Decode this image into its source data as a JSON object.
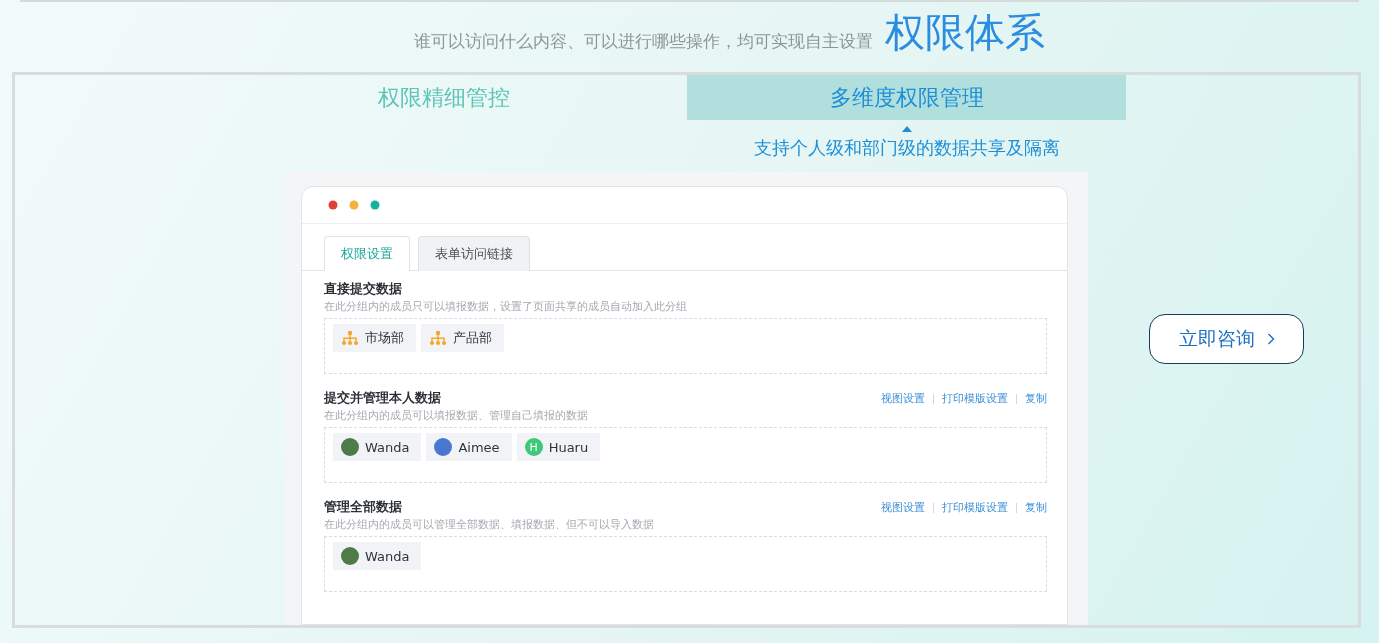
{
  "header": {
    "subtitle": "谁可以访问什么内容、可以进行哪些操作，均可实现自主设置",
    "title": "权限体系"
  },
  "tabs": [
    {
      "label": "权限精细管控",
      "selected": false
    },
    {
      "label": "多维度权限管理",
      "selected": true
    }
  ],
  "tab_caption": "支持个人级和部门级的数据共享及隔离",
  "app_window": {
    "tabs": [
      {
        "label": "权限设置",
        "selected": true
      },
      {
        "label": "表单访问链接",
        "selected": false
      }
    ],
    "groups": [
      {
        "title": "直接提交数据",
        "description": "在此分组内的成员只可以填报数据，设置了页面共享的成员自动加入此分组",
        "members": [
          {
            "kind": "department",
            "name": "市场部"
          },
          {
            "kind": "department",
            "name": "产品部"
          }
        ]
      },
      {
        "title": "提交并管理本人数据",
        "description": "在此分组内的成员可以填报数据、管理自己填报的数据",
        "actions": [
          "视图设置",
          "打印模版设置",
          "复制"
        ],
        "members": [
          {
            "kind": "photo",
            "name": "Wanda",
            "color": "#4f7a4a"
          },
          {
            "kind": "photo",
            "name": "Aimee",
            "color": "#4a78d0"
          },
          {
            "kind": "letter",
            "letter": "H",
            "name": "Huaru",
            "color": "#3ec97a"
          }
        ]
      },
      {
        "title": "管理全部数据",
        "description": "在此分组内的成员可以管理全部数据、填报数据、但不可以导入数据",
        "actions": [
          "视图设置",
          "打印模版设置",
          "复制"
        ],
        "members": [
          {
            "kind": "photo",
            "name": "Wanda",
            "color": "#4f7a4a"
          }
        ]
      }
    ]
  },
  "consult_button": {
    "label": "立即咨询"
  }
}
